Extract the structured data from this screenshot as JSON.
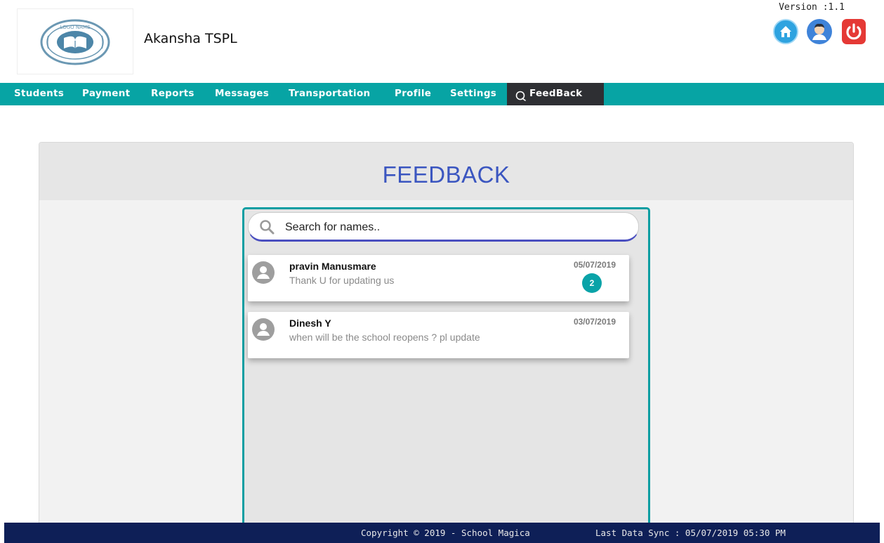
{
  "header": {
    "logo_text": "LOGO NAME",
    "org_name": "Akansha TSPL",
    "version": "Version :1.1",
    "icons": [
      "home-icon",
      "user-profile-icon",
      "power-icon"
    ]
  },
  "nav": {
    "items": [
      "Students",
      "Payment",
      "Reports",
      "Messages",
      "Transportation",
      "Profile",
      "Settings"
    ],
    "active": "FeedBack"
  },
  "panel": {
    "title": "FEEDBACK"
  },
  "search": {
    "placeholder": "Search for names.."
  },
  "feedback": [
    {
      "name": "pravin Manusmare",
      "message": "Thank U for updating us",
      "date": "05/07/2019",
      "unread": "2"
    },
    {
      "name": "Dinesh Y",
      "message": "when will be the school reopens ? pl update",
      "date": "03/07/2019",
      "unread": ""
    }
  ],
  "footer": {
    "copyright": "Copyright © 2019 - School Magica",
    "sync": "Last Data Sync : 05/07/2019 05:30 PM"
  },
  "colors": {
    "nav": "#07a4a4",
    "active_nav": "#2e2f33",
    "title": "#3b56c0",
    "footer": "#0e1f57",
    "badge": "#0aa3a8"
  }
}
